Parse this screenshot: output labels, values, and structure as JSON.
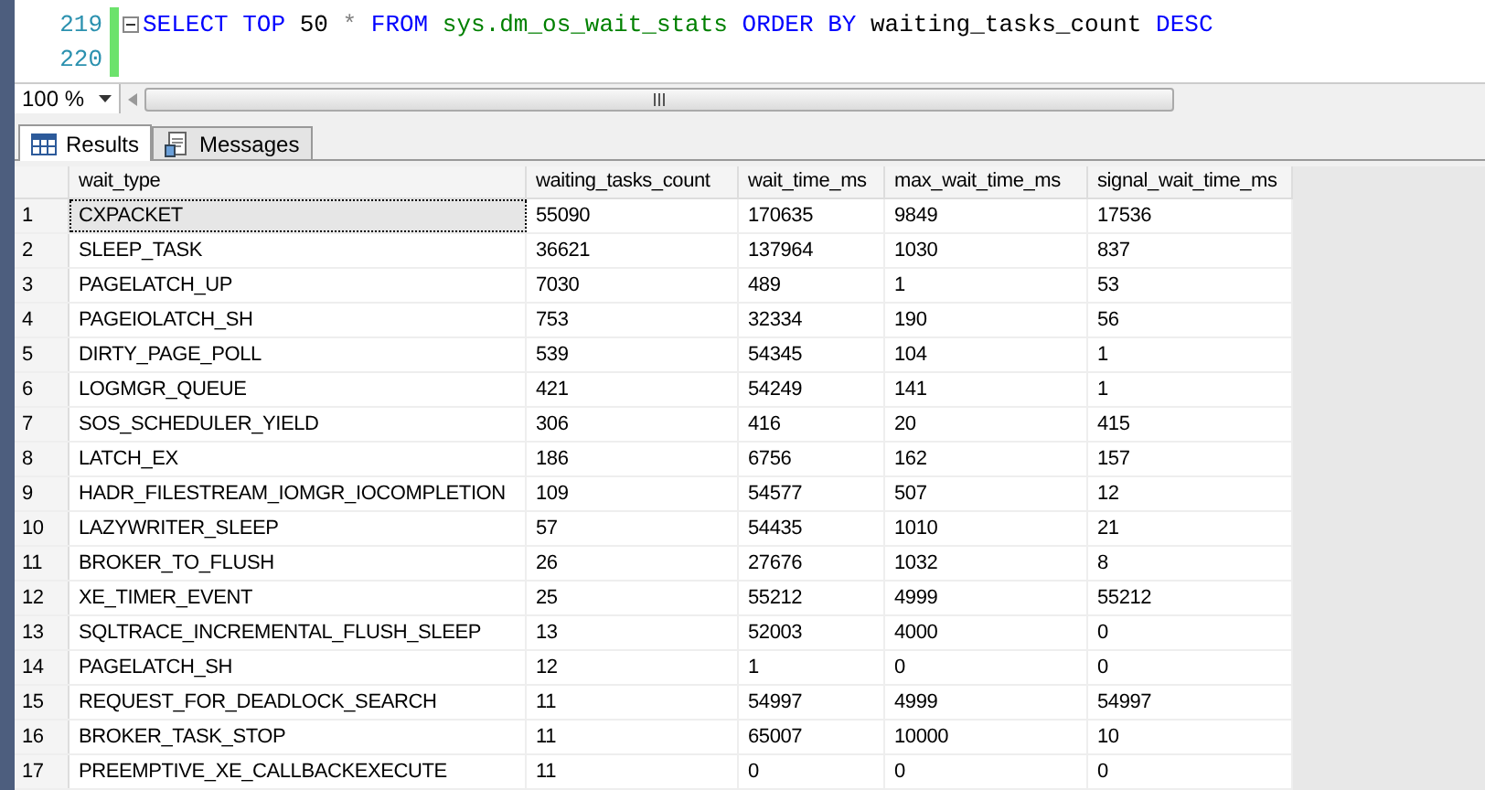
{
  "editor": {
    "lines": [
      {
        "number": "219",
        "collapsible": true,
        "tokens": [
          {
            "kind": "keyword",
            "text": "SELECT"
          },
          {
            "kind": "keyword",
            "text": "TOP"
          },
          {
            "kind": "plain",
            "text": "50"
          },
          {
            "kind": "operator",
            "text": "*"
          },
          {
            "kind": "keyword",
            "text": "FROM"
          },
          {
            "kind": "system",
            "text": "sys.dm_os_wait_stats"
          },
          {
            "kind": "keyword",
            "text": "ORDER BY"
          },
          {
            "kind": "plain",
            "text": "waiting_tasks_count"
          },
          {
            "kind": "keyword",
            "text": "DESC"
          }
        ]
      },
      {
        "number": "220",
        "collapsible": false
      }
    ]
  },
  "zoom": {
    "value": "100 %"
  },
  "tabs": [
    {
      "label": "Results",
      "selected": true
    },
    {
      "label": "Messages",
      "selected": false
    }
  ],
  "grid": {
    "columns": [
      "wait_type",
      "waiting_tasks_count",
      "wait_time_ms",
      "max_wait_time_ms",
      "signal_wait_time_ms"
    ],
    "rows": [
      {
        "number": "1",
        "selected": true,
        "cells": [
          "CXPACKET",
          "55090",
          "170635",
          "9849",
          "17536"
        ]
      },
      {
        "number": "2",
        "selected": false,
        "cells": [
          "SLEEP_TASK",
          "36621",
          "137964",
          "1030",
          "837"
        ]
      },
      {
        "number": "3",
        "selected": false,
        "cells": [
          "PAGELATCH_UP",
          "7030",
          "489",
          "1",
          "53"
        ]
      },
      {
        "number": "4",
        "selected": false,
        "cells": [
          "PAGEIOLATCH_SH",
          "753",
          "32334",
          "190",
          "56"
        ]
      },
      {
        "number": "5",
        "selected": false,
        "cells": [
          "DIRTY_PAGE_POLL",
          "539",
          "54345",
          "104",
          "1"
        ]
      },
      {
        "number": "6",
        "selected": false,
        "cells": [
          "LOGMGR_QUEUE",
          "421",
          "54249",
          "141",
          "1"
        ]
      },
      {
        "number": "7",
        "selected": false,
        "cells": [
          "SOS_SCHEDULER_YIELD",
          "306",
          "416",
          "20",
          "415"
        ]
      },
      {
        "number": "8",
        "selected": false,
        "cells": [
          "LATCH_EX",
          "186",
          "6756",
          "162",
          "157"
        ]
      },
      {
        "number": "9",
        "selected": false,
        "cells": [
          "HADR_FILESTREAM_IOMGR_IOCOMPLETION",
          "109",
          "54577",
          "507",
          "12"
        ]
      },
      {
        "number": "10",
        "selected": false,
        "cells": [
          "LAZYWRITER_SLEEP",
          "57",
          "54435",
          "1010",
          "21"
        ]
      },
      {
        "number": "11",
        "selected": false,
        "cells": [
          "BROKER_TO_FLUSH",
          "26",
          "27676",
          "1032",
          "8"
        ]
      },
      {
        "number": "12",
        "selected": false,
        "cells": [
          "XE_TIMER_EVENT",
          "25",
          "55212",
          "4999",
          "55212"
        ]
      },
      {
        "number": "13",
        "selected": false,
        "cells": [
          "SQLTRACE_INCREMENTAL_FLUSH_SLEEP",
          "13",
          "52003",
          "4000",
          "0"
        ]
      },
      {
        "number": "14",
        "selected": false,
        "cells": [
          "PAGELATCH_SH",
          "12",
          "1",
          "0",
          "0"
        ]
      },
      {
        "number": "15",
        "selected": false,
        "cells": [
          "REQUEST_FOR_DEADLOCK_SEARCH",
          "11",
          "54997",
          "4999",
          "54997"
        ]
      },
      {
        "number": "16",
        "selected": false,
        "cells": [
          "BROKER_TASK_STOP",
          "11",
          "65007",
          "10000",
          "10"
        ]
      },
      {
        "number": "17",
        "selected": false,
        "cells": [
          "PREEMPTIVE_XE_CALLBACKEXECUTE",
          "11",
          "0",
          "0",
          "0"
        ]
      }
    ]
  }
}
